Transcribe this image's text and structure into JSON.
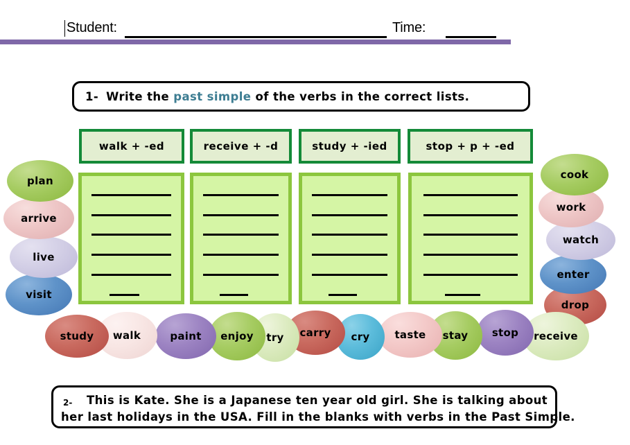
{
  "header": {
    "student_label": "Student:",
    "time_label": "Time:"
  },
  "exercise1": {
    "number": "1-",
    "text_before": "Write the ",
    "accent": "past simple",
    "text_after": " of the verbs in the correct lists.",
    "columns": [
      {
        "header": "walk + -ed"
      },
      {
        "header": "receive + -d"
      },
      {
        "header": "study + -ied"
      },
      {
        "header": "stop + p + -ed"
      }
    ]
  },
  "exercise2": {
    "number": "2-",
    "line1": "This is Kate. She is a Japanese ten year old girl. She is talking about",
    "line2": "her last holidays in the USA. Fill in the blanks with verbs in the Past Simple."
  },
  "word_bank": {
    "left": [
      {
        "word": "plan",
        "color": "green"
      },
      {
        "word": "arrive",
        "color": "pink"
      },
      {
        "word": "live",
        "color": "lav"
      },
      {
        "word": "visit",
        "color": "blue"
      }
    ],
    "right": [
      {
        "word": "cook",
        "color": "green"
      },
      {
        "word": "work",
        "color": "pink"
      },
      {
        "word": "watch",
        "color": "lav"
      },
      {
        "word": "enter",
        "color": "blue"
      },
      {
        "word": "drop",
        "color": "red"
      }
    ],
    "bottom": [
      {
        "word": "study",
        "color": "red"
      },
      {
        "word": "walk",
        "color": "palepink"
      },
      {
        "word": "paint",
        "color": "purple"
      },
      {
        "word": "enjoy",
        "color": "green"
      },
      {
        "word": "try",
        "color": "palegreen"
      },
      {
        "word": "carry",
        "color": "red"
      },
      {
        "word": "cry",
        "color": "cyan"
      },
      {
        "word": "taste",
        "color": "softpink"
      },
      {
        "word": "stay",
        "color": "green"
      },
      {
        "word": "stop",
        "color": "purple"
      },
      {
        "word": "receive",
        "color": "palegreen"
      }
    ]
  },
  "colors": {
    "divider_purple": "#7f68a8",
    "header_border_green": "#148a38",
    "header_fill_green": "#e3eed1",
    "answer_border_green": "#8cc63e",
    "answer_fill_green": "#d5f5a5",
    "accent_teal": "#3d7d92"
  }
}
